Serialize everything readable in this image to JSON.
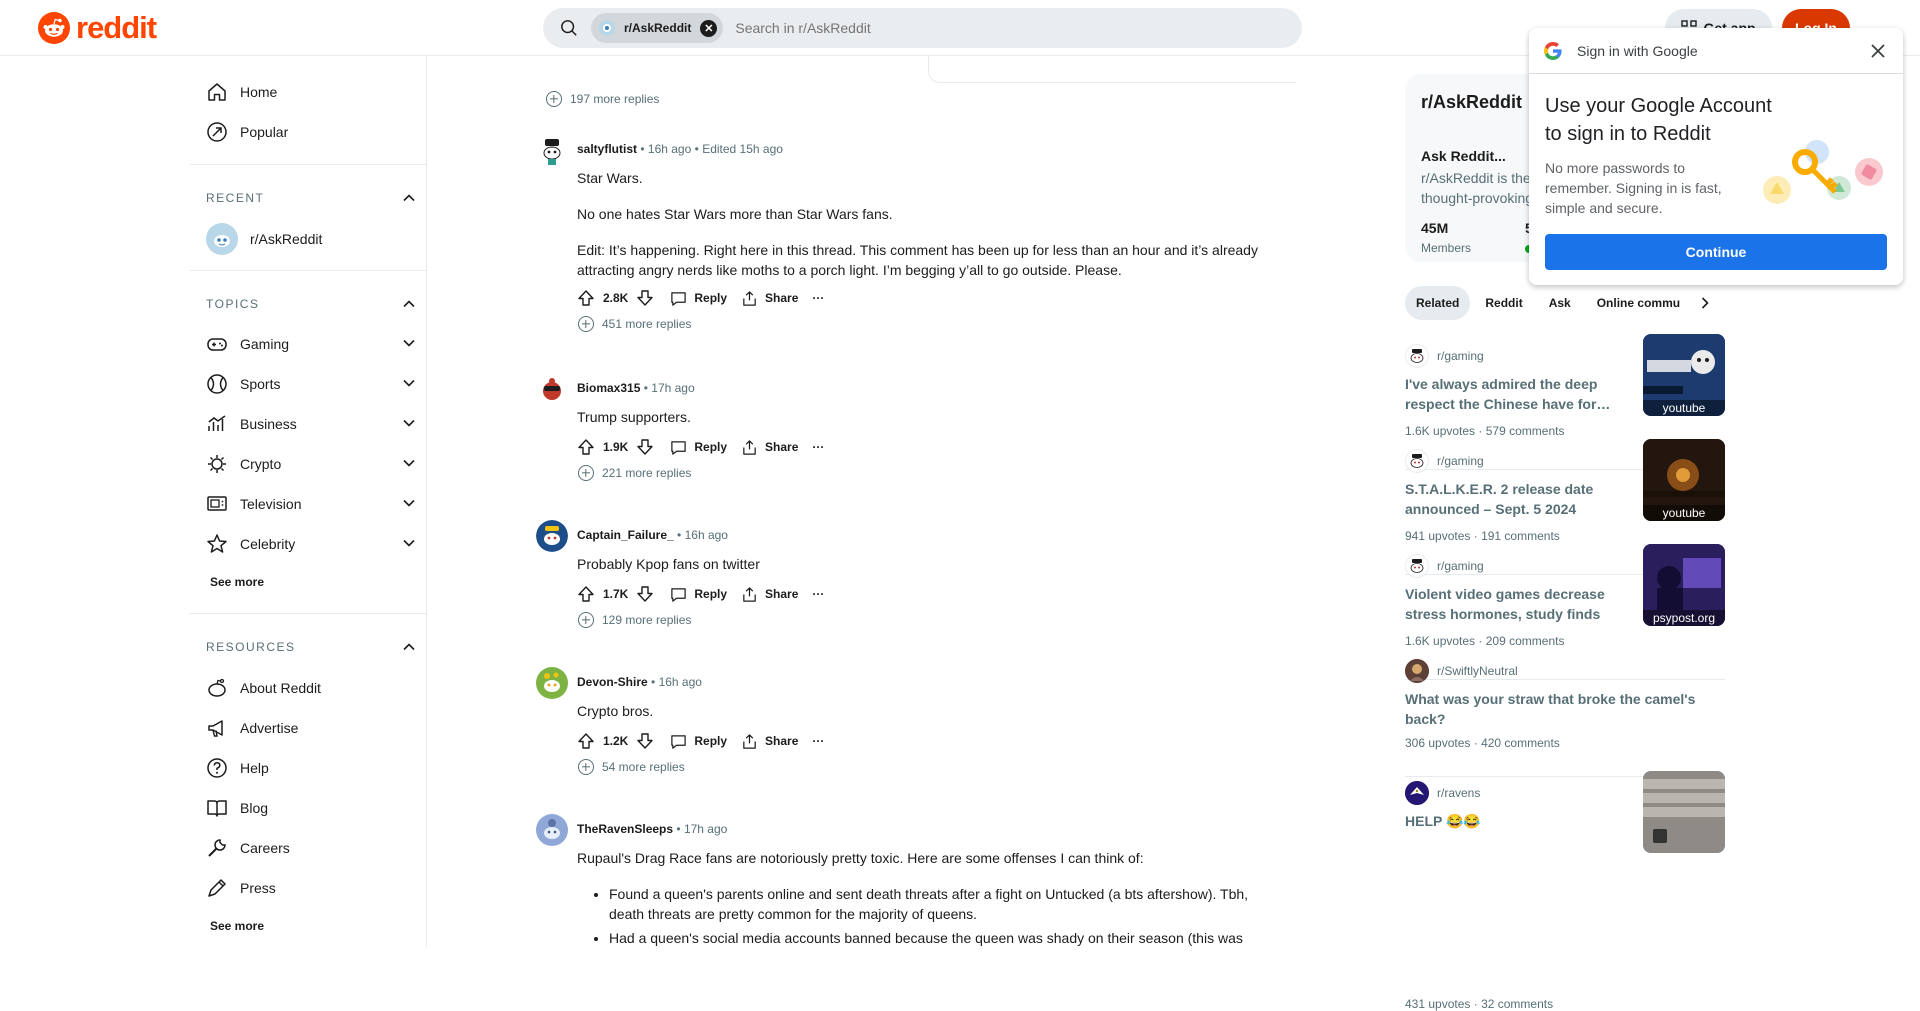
{
  "header": {
    "logo_text": "reddit",
    "search_chip": "r/AskReddit",
    "search_placeholder": "Search in r/AskReddit",
    "get_app": "Get app",
    "login": "Log In"
  },
  "sidebar": {
    "nav": [
      {
        "label": "Home",
        "icon": "home-icon"
      },
      {
        "label": "Popular",
        "icon": "popular-icon"
      }
    ],
    "recent": {
      "heading": "RECENT",
      "items": [
        {
          "label": "r/AskReddit"
        }
      ]
    },
    "topics": {
      "heading": "TOPICS",
      "items": [
        {
          "label": "Gaming",
          "icon": "gaming-icon"
        },
        {
          "label": "Sports",
          "icon": "sports-icon"
        },
        {
          "label": "Business",
          "icon": "business-icon"
        },
        {
          "label": "Crypto",
          "icon": "crypto-icon"
        },
        {
          "label": "Television",
          "icon": "television-icon"
        },
        {
          "label": "Celebrity",
          "icon": "celebrity-icon"
        }
      ],
      "see_more": "See more"
    },
    "resources": {
      "heading": "RESOURCES",
      "items": [
        {
          "label": "About Reddit",
          "icon": "about-icon"
        },
        {
          "label": "Advertise",
          "icon": "advertise-icon"
        },
        {
          "label": "Help",
          "icon": "help-icon"
        },
        {
          "label": "Blog",
          "icon": "blog-icon"
        },
        {
          "label": "Careers",
          "icon": "careers-icon"
        },
        {
          "label": "Press",
          "icon": "press-icon"
        }
      ],
      "see_more": "See more"
    }
  },
  "comments": {
    "top_more_replies": "197 more replies",
    "items": [
      {
        "author": "saltyflutist",
        "time": "16h ago",
        "edited": "Edited 15h ago",
        "paragraphs": [
          "Star Wars.",
          "No one hates Star Wars more than Star Wars fans.",
          "Edit: It’s happening. Right here in this thread. This comment has been up for less than an hour and it’s already attracting angry nerds like moths to a porch light. I’m begging y’all to go outside. Please."
        ],
        "votes": "2.8K",
        "more_replies": "451 more replies"
      },
      {
        "author": "Biomax315",
        "time": "17h ago",
        "paragraphs": [
          "Trump supporters."
        ],
        "votes": "1.9K",
        "more_replies": "221 more replies"
      },
      {
        "author": "Captain_Failure_",
        "time": "16h ago",
        "paragraphs": [
          "Probably Kpop fans on twitter"
        ],
        "votes": "1.7K",
        "more_replies": "129 more replies"
      },
      {
        "author": "Devon-Shire",
        "time": "16h ago",
        "paragraphs": [
          "Crypto bros."
        ],
        "votes": "1.2K",
        "more_replies": "54 more replies"
      },
      {
        "author": "TheRavenSleeps",
        "time": "17h ago",
        "paragraphs": [
          "Rupaul's Drag Race fans are notoriously pretty toxic. Here are some offenses I can think of:"
        ],
        "bullets": [
          "Found a queen's parents online and sent death threats after a fight on Untucked (a bts aftershow). Tbh, death threats are pretty common for the majority of queens.",
          "Had a queen's social media accounts banned because the queen was shady on their season (this was"
        ]
      }
    ],
    "action_labels": {
      "reply": "Reply",
      "share": "Share",
      "more": "···"
    }
  },
  "rail": {
    "sub_card": {
      "name": "r/AskReddit",
      "title": "Ask Reddit...",
      "desc_line1": "r/AskReddit is the",
      "desc_line2": "thought-provoking",
      "members": "45M",
      "members_label": "Members",
      "online_partial": "5"
    },
    "tabs": [
      "Related",
      "Reddit",
      "Ask",
      "Online commu"
    ],
    "related": [
      {
        "sub": "r/gaming",
        "title": "I've always admired the deep respect the Chinese have for…",
        "upvotes": "1.6K upvotes",
        "comments": "579 comments",
        "thumb_source": "youtube",
        "thumb_color": "#1d3b6e"
      },
      {
        "sub": "r/gaming",
        "title": "S.T.A.L.K.E.R. 2 release date announced – Sept. 5 2024",
        "upvotes": "941 upvotes",
        "comments": "191 comments",
        "thumb_source": "youtube",
        "thumb_color": "#3a2a1c"
      },
      {
        "sub": "r/gaming",
        "title": "Violent video games decrease stress hormones, study finds",
        "upvotes": "1.6K upvotes",
        "comments": "209 comments",
        "thumb_source": "psypost.org",
        "thumb_color": "#3d2f7a"
      },
      {
        "sub": "r/SwiftlyNeutral",
        "title": "What was your straw that broke the camel's back?",
        "upvotes": "306 upvotes",
        "comments": "420 comments"
      },
      {
        "sub": "r/ravens",
        "title": "HELP 😂😂",
        "upvotes": "431 upvotes",
        "comments": "32 comments",
        "thumb_color": "#8e8a86"
      }
    ]
  },
  "google_popup": {
    "title": "Sign in with Google",
    "headline": "Use your Google Account to sign in to Reddit",
    "sub": "No more passwords to remember. Signing in is fast, simple and secure.",
    "continue": "Continue"
  },
  "colors": {
    "brand": "#ff4500",
    "login_bg": "#d93900",
    "google_blue": "#1a73e8",
    "muted": "#576f76"
  }
}
